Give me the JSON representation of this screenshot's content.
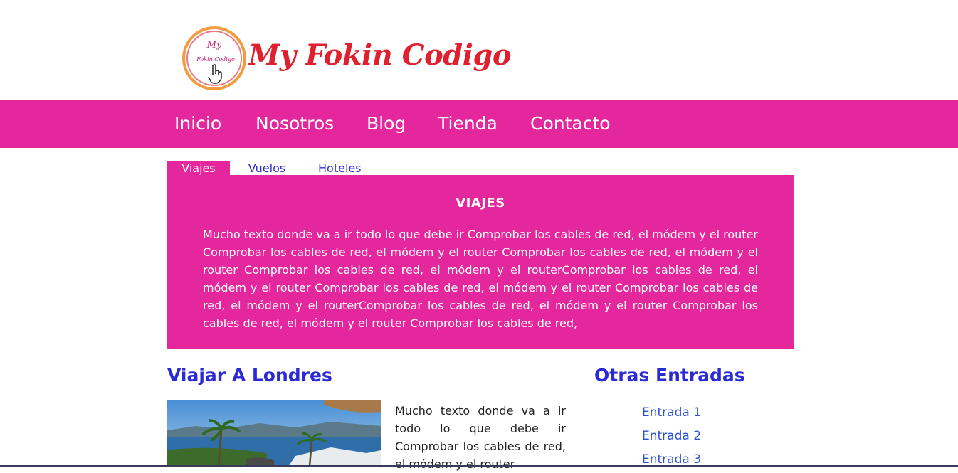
{
  "brand": {
    "logo_mark_text_top": "My",
    "logo_mark_text_bottom": "Fokin Codigo",
    "logo_text": "My Fokin Codigo",
    "colors": {
      "primary": "#e5279e",
      "logo_red": "#e0202e",
      "logo_orange": "#f0922a",
      "link_blue": "#2b2bd6"
    }
  },
  "nav": {
    "items": [
      {
        "label": "Inicio"
      },
      {
        "label": "Nosotros"
      },
      {
        "label": "Blog"
      },
      {
        "label": "Tienda"
      },
      {
        "label": "Contacto"
      }
    ]
  },
  "tabs": {
    "items": [
      {
        "label": "Viajes",
        "active": true
      },
      {
        "label": "Vuelos",
        "active": false
      },
      {
        "label": "Hoteles",
        "active": false
      }
    ]
  },
  "panel": {
    "title": "VIAJES",
    "text": "Mucho texto donde va a ir todo lo que debe ir Comprobar los cables de red, el módem y el router Comprobar los cables de red, el módem y el router Comprobar los cables de red, el módem y el router Comprobar los cables de red, el módem y el routerComprobar los cables de red, el módem y el router Comprobar los cables de red, el módem y el router Comprobar los cables de red, el módem y el routerComprobar los cables de red, el módem y el router Comprobar los cables de red, el módem y el router Comprobar los cables de red,"
  },
  "post": {
    "title": "Viajar A Londres",
    "text": "Mucho texto donde va a ir todo lo que debe ir Comprobar los cables de red, el módem y el router"
  },
  "sidebar": {
    "title": "Otras Entradas",
    "links": [
      {
        "label": "Entrada 1"
      },
      {
        "label": "Entrada 2"
      },
      {
        "label": "Entrada 3"
      }
    ]
  }
}
